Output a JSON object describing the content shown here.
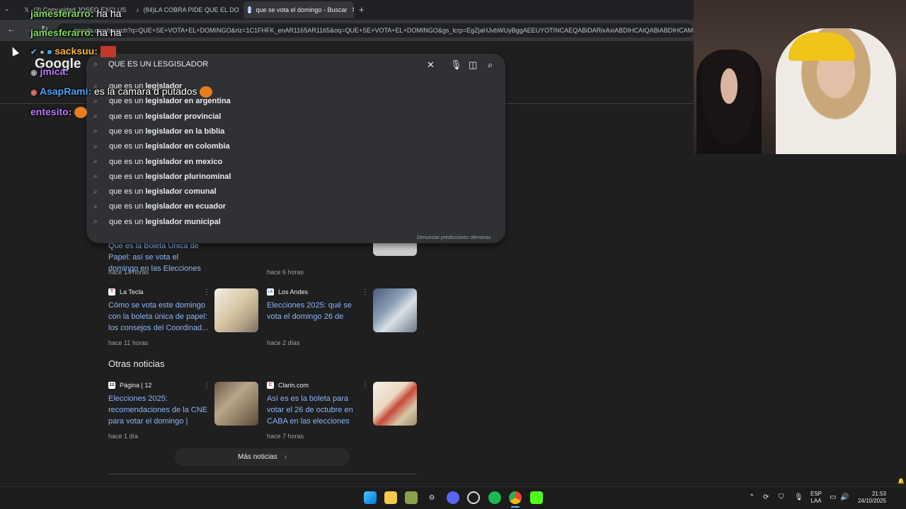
{
  "tabs": [
    {
      "label": "(3) Comunidad JOSEO EXCLUSI...",
      "icon": "x-logo-icon"
    },
    {
      "label": "(84)LA COBRA PIDE QUE EL DO...",
      "icon": "tiktok-icon"
    },
    {
      "label": "que se vota el domingo - Buscar",
      "icon": "google-icon"
    }
  ],
  "address": {
    "url": "google.com/search?q=QUE+SE+VOTA+EL+DOMINGO&rlz=1C1FHFK_enAR1165AR1165&oq=QUE+SE+VOTA+EL+DOMINGO&gs_lcrp=EgZjaHJvbWUyBggAEEUYOTINCAEQABiDARixAxiABDIHCAIQABiABDIHCAMQ"
  },
  "google_logo": "Google",
  "search": {
    "query": "QUE ES UN LESGISLADOR"
  },
  "suggestions": [
    {
      "prefix": "que es un ",
      "rest": "legislador"
    },
    {
      "prefix": "que es un ",
      "rest": "legislador en argentina"
    },
    {
      "prefix": "que es un ",
      "rest": "legislador provincial"
    },
    {
      "prefix": "que es un ",
      "rest": "legislador en la biblia"
    },
    {
      "prefix": "que es un ",
      "rest": "legislador en colombia"
    },
    {
      "prefix": "que es un ",
      "rest": "legislador en mexico"
    },
    {
      "prefix": "que es un ",
      "rest": "legislador plurinominal"
    },
    {
      "prefix": "que es un ",
      "rest": "legislador comunal"
    },
    {
      "prefix": "que es un ",
      "rest": "legislador en ecuador"
    },
    {
      "prefix": "que es un ",
      "rest": "legislador municipal"
    }
  ],
  "report_link": "Denunciar predicciones ofensivas",
  "news_top": [
    {
      "title": "Qué es la Boleta Única de Papel: así se vota el domingo en las Elecciones Argenti...",
      "time": "hace 14 horas"
    },
    {
      "title": "",
      "time": "hace 6 horas"
    }
  ],
  "news_mid": [
    {
      "source": "La Tecla",
      "logo": "T",
      "logo_color": "#c62828",
      "title": "Cómo se vota este domingo con la boleta única de papel: los consejos del Coordinad...",
      "time": "hace 11 horas"
    },
    {
      "source": "Los Andes",
      "logo": "LA",
      "logo_color": "#1565c0",
      "title": "Elecciones 2025: qué se vota el domingo 26 de octubre",
      "time": "hace 2 días"
    }
  ],
  "otras_noticias": "Otras noticias",
  "news_bottom": [
    {
      "source": "Página | 12",
      "logo": "12",
      "logo_color": "#ffffff",
      "title": "Elecciones 2025: recomendaciones de la CNE para votar el domingo | Tod...",
      "time": "hace 1 día"
    },
    {
      "source": "Clarin.com",
      "logo": "C",
      "logo_color": "#d32f2f",
      "title": "Así es es la boleta para votar el 26 de octubre en CABA en las elecciones 2025",
      "time": "hace 7 horas"
    }
  ],
  "more_news": "Más noticias",
  "chat": [
    {
      "user": "jamesferarro:",
      "msg": " ha ha",
      "color": "#7ed957"
    },
    {
      "user": "jamesferarro:",
      "msg": " ha ha",
      "color": "#7ed957"
    },
    {
      "user": "sacksuu:",
      "msg": "",
      "color": "#ffb13b"
    },
    {
      "user": "jmica:",
      "msg": "",
      "color": "#b57bff"
    },
    {
      "user": "AsapRami:",
      "msg": " es la camara d putados",
      "color": "#4aa3ff"
    },
    {
      "user": "entesito:",
      "msg": "",
      "color": "#b57bff"
    }
  ],
  "taskbar": {
    "lang": "ESP",
    "lang2": "LAA",
    "time": "21:53",
    "date": "24/10/2025"
  }
}
